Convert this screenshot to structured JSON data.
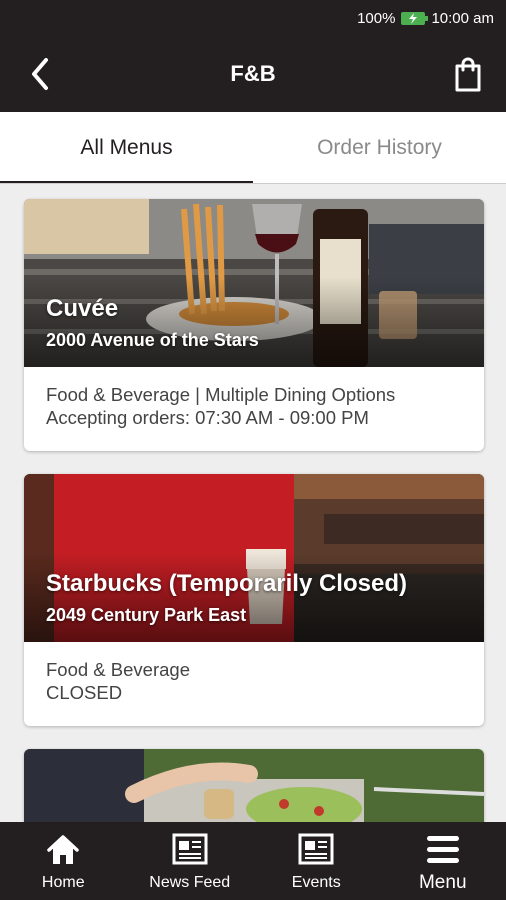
{
  "status_bar": {
    "battery_percent": "100%",
    "time": "10:00 am"
  },
  "app_bar": {
    "title": "F&B",
    "back_icon": "chevron-left-icon",
    "cart_icon": "shopping-bag-icon"
  },
  "tabs": [
    {
      "label": "All Menus",
      "active": true
    },
    {
      "label": "Order History",
      "active": false
    }
  ],
  "venues": [
    {
      "name": "Cuvée",
      "address": "2000 Avenue of the Stars",
      "category": "Food & Beverage | Multiple Dining Options",
      "status": "Accepting orders: 07:30 AM - 09:00 PM"
    },
    {
      "name": "Starbucks (Temporarily Closed)",
      "address": "2049 Century Park East",
      "category": "Food & Beverage",
      "status": "CLOSED"
    }
  ],
  "bottom_nav": [
    {
      "label": "Home",
      "icon": "home-icon"
    },
    {
      "label": "News Feed",
      "icon": "newspaper-icon"
    },
    {
      "label": "Events",
      "icon": "newspaper-icon"
    },
    {
      "label": "Menu",
      "icon": "hamburger-menu-icon"
    }
  ],
  "colors": {
    "bar_background": "#231f20",
    "battery": "#4caf50",
    "page_background": "#eeeeee"
  }
}
